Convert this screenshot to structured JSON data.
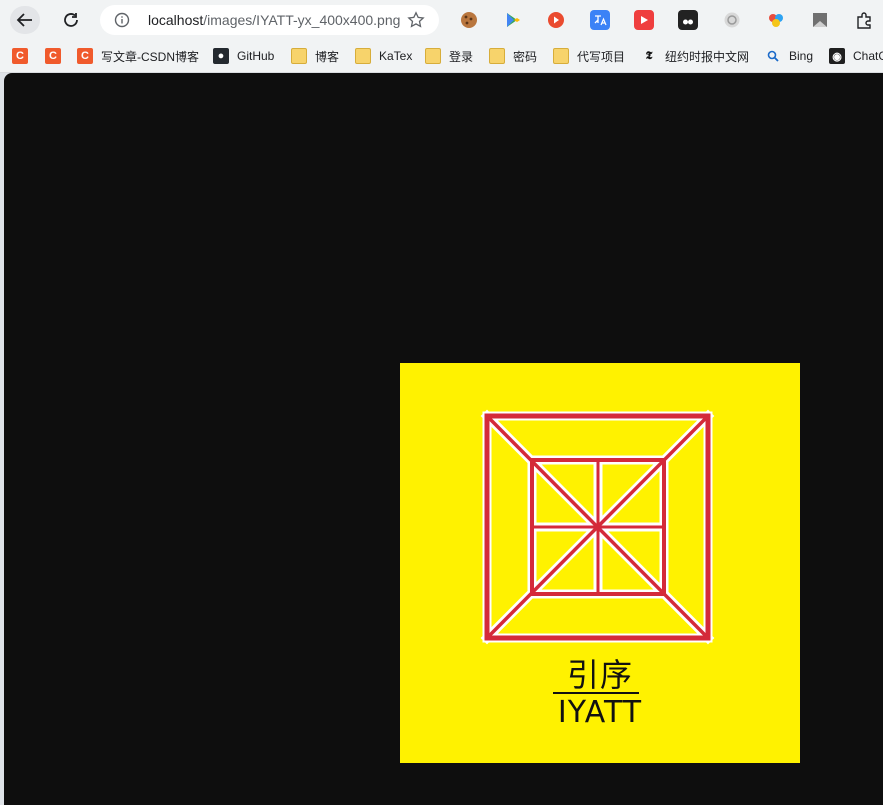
{
  "browser": {
    "url_host": "localhost",
    "url_path": "/images/IYATT-yx_400x400.png",
    "extensions": [
      "cookie-editor-icon",
      "google-play-icon",
      "youtube-icon",
      "translate-icon",
      "video-download-icon",
      "tampermonkey-icon",
      "openai-icon",
      "color-picker-icon",
      "bookmark-flag-icon",
      "extensions-icon"
    ]
  },
  "bookmarks": [
    {
      "label": "",
      "icon": "C"
    },
    {
      "label": "",
      "icon": "C"
    },
    {
      "label": "写文章-CSDN博客",
      "icon": "C"
    },
    {
      "label": "GitHub",
      "icon": "github"
    },
    {
      "label": "博客",
      "icon": "folder"
    },
    {
      "label": "KaTex",
      "icon": "folder"
    },
    {
      "label": "登录",
      "icon": "folder"
    },
    {
      "label": "密码",
      "icon": "folder"
    },
    {
      "label": "代写项目",
      "icon": "folder"
    },
    {
      "label": "纽约时报中文网",
      "icon": "nyt"
    },
    {
      "label": "Bing",
      "icon": "bing"
    },
    {
      "label": "ChatG",
      "icon": "chatgpt"
    }
  ],
  "image": {
    "title_cn": "引序",
    "title_en": "IYATT",
    "colors": {
      "background": "#fff200",
      "frame": "#d42a3a",
      "text": "#111111"
    }
  }
}
